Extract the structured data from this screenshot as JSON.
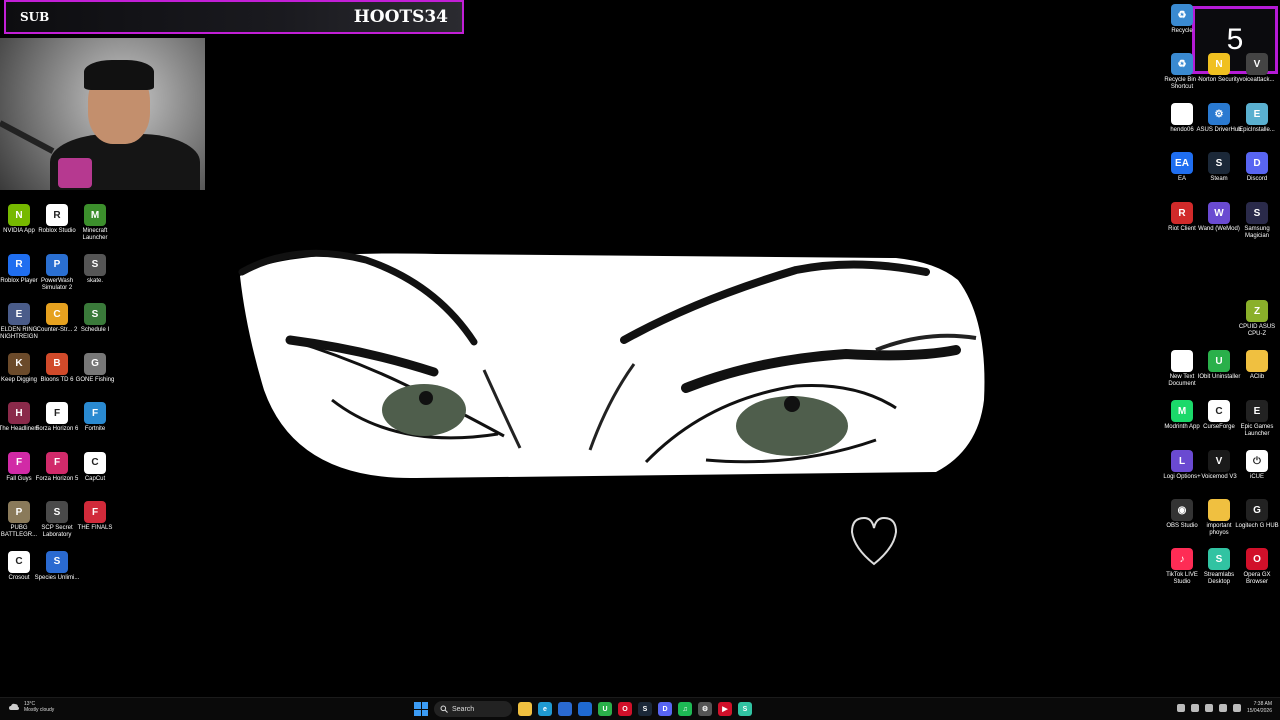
{
  "overlay": {
    "sub_label": "SUB",
    "sub_name": "HOOTS34",
    "countdown": "5"
  },
  "left_icons": [
    {
      "label": "NVIDIA App",
      "icon": "nvidia-icon",
      "color": "#76b900",
      "glyph": "N"
    },
    {
      "label": "Roblox Studio",
      "icon": "roblox-studio-icon",
      "color": "#ffffff",
      "glyph": "R"
    },
    {
      "label": "Minecraft Launcher",
      "icon": "minecraft-icon",
      "color": "#3c8f2c",
      "glyph": "M"
    },
    {
      "label": "Roblox Player",
      "icon": "roblox-player-icon",
      "color": "#1f6ef0",
      "glyph": "R"
    },
    {
      "label": "PowerWash Simulator 2",
      "icon": "powerwash-icon",
      "color": "#2a6fd1",
      "glyph": "P"
    },
    {
      "label": "skate.",
      "icon": "skate-icon",
      "color": "#555555",
      "glyph": "S"
    },
    {
      "label": "ELDEN RING NIGHTREIGN",
      "icon": "elden-ring-icon",
      "color": "#4a5c8a",
      "glyph": "E"
    },
    {
      "label": "Counter-Str... 2",
      "icon": "counter-strike-icon",
      "color": "#e6a11f",
      "glyph": "C"
    },
    {
      "label": "Schedule I",
      "icon": "schedule-icon",
      "color": "#3a7a3a",
      "glyph": "S"
    },
    {
      "label": "Keep Digging",
      "icon": "keep-digging-icon",
      "color": "#6b4a2a",
      "glyph": "K"
    },
    {
      "label": "Bloons TD 6",
      "icon": "bloons-icon",
      "color": "#d14a2a",
      "glyph": "B"
    },
    {
      "label": "GONE Fishing",
      "icon": "gone-fishing-icon",
      "color": "#777777",
      "glyph": "G"
    },
    {
      "label": "The Headliners",
      "icon": "headliners-icon",
      "color": "#8a2a4a",
      "glyph": "H"
    },
    {
      "label": "Forza Horizon 6",
      "icon": "forza6-icon",
      "color": "#ffffff",
      "glyph": "F"
    },
    {
      "label": "Fortnite",
      "icon": "fortnite-icon",
      "color": "#2a8ad1",
      "glyph": "F"
    },
    {
      "label": "Fall Guys",
      "icon": "fall-guys-icon",
      "color": "#d12aa6",
      "glyph": "F"
    },
    {
      "label": "Forza Horizon 5",
      "icon": "forza5-icon",
      "color": "#d12a6a",
      "glyph": "F"
    },
    {
      "label": "CapCut",
      "icon": "capcut-icon",
      "color": "#ffffff",
      "glyph": "C"
    },
    {
      "label": "PUBG BATTLEGR...",
      "icon": "pubg-icon",
      "color": "#8a7a5a",
      "glyph": "P"
    },
    {
      "label": "SCP Secret Laboratory",
      "icon": "scp-icon",
      "color": "#4a4a4a",
      "glyph": "S"
    },
    {
      "label": "THE FINALS",
      "icon": "the-finals-icon",
      "color": "#d12a3a",
      "glyph": "F"
    },
    {
      "label": "Crosout",
      "icon": "crosout-icon",
      "color": "#ffffff",
      "glyph": "C"
    },
    {
      "label": "Species Unlimi...",
      "icon": "species-icon",
      "color": "#2a6ad1",
      "glyph": "S"
    }
  ],
  "right_icons": [
    {
      "label": "Recycle",
      "icon": "recycle-bin-icon",
      "color": "#3a8ad1",
      "glyph": "♻"
    },
    {
      "label": "Recycle Bin - Shortcut",
      "icon": "recycle-bin-shortcut-icon",
      "color": "#3a8ad1",
      "glyph": "♻"
    },
    {
      "label": "Norton Security",
      "icon": "norton-icon",
      "color": "#f0c020",
      "glyph": "N"
    },
    {
      "label": "voiceattack...",
      "icon": "voiceattack-icon",
      "color": "#444444",
      "glyph": "V"
    },
    {
      "label": "hendo06",
      "icon": "file-icon",
      "color": "#ffffff",
      "glyph": ""
    },
    {
      "label": "ASUS DriverHub",
      "icon": "asus-driverhub-icon",
      "color": "#2a7ad1",
      "glyph": "⚙"
    },
    {
      "label": "EpicInstalle...",
      "icon": "epic-installer-icon",
      "color": "#5ab0d0",
      "glyph": "E"
    },
    {
      "label": "EA",
      "icon": "ea-icon",
      "color": "#1f6ef0",
      "glyph": "EA"
    },
    {
      "label": "Steam",
      "icon": "steam-icon",
      "color": "#1b2838",
      "glyph": "S"
    },
    {
      "label": "Discord",
      "icon": "discord-icon",
      "color": "#5865f2",
      "glyph": "D"
    },
    {
      "label": "Riot Client",
      "icon": "riot-client-icon",
      "color": "#d12a2a",
      "glyph": "R"
    },
    {
      "label": "Wand (WeMod)",
      "icon": "wand-icon",
      "color": "#6a4ad1",
      "glyph": "W"
    },
    {
      "label": "Samsung Magician",
      "icon": "samsung-magician-icon",
      "color": "#2a2a4a",
      "glyph": "S"
    },
    {
      "label": "CPUID ASUS CPU-Z",
      "icon": "cpuz-icon",
      "color": "#8ab02a",
      "glyph": "Z"
    },
    {
      "label": "New Text Document",
      "icon": "text-document-icon",
      "color": "#ffffff",
      "glyph": ""
    },
    {
      "label": "IObit Uninstaller",
      "icon": "iobit-icon",
      "color": "#2ab04a",
      "glyph": "U"
    },
    {
      "label": "AClib",
      "icon": "folder-icon",
      "color": "#f0c040",
      "glyph": ""
    },
    {
      "label": "Modrinth App",
      "icon": "modrinth-icon",
      "color": "#1bd96a",
      "glyph": "M"
    },
    {
      "label": "CurseForge",
      "icon": "curseforge-icon",
      "color": "#ffffff",
      "glyph": "C"
    },
    {
      "label": "Epic Games Launcher",
      "icon": "epic-games-icon",
      "color": "#222222",
      "glyph": "E"
    },
    {
      "label": "Logi Options+",
      "icon": "logi-options-icon",
      "color": "#6a4ad1",
      "glyph": "L"
    },
    {
      "label": "Voicemod V3",
      "icon": "voicemod-icon",
      "color": "#1a1a1a",
      "glyph": "V"
    },
    {
      "label": "iCUE",
      "icon": "icue-icon",
      "color": "#ffffff",
      "glyph": "⏻"
    },
    {
      "label": "OBS Studio",
      "icon": "obs-icon",
      "color": "#333333",
      "glyph": "◉"
    },
    {
      "label": "important phoyos",
      "icon": "folder-important-icon",
      "color": "#f0c040",
      "glyph": ""
    },
    {
      "label": "Logitech G HUB",
      "icon": "logitech-ghub-icon",
      "color": "#222222",
      "glyph": "G"
    },
    {
      "label": "TikTok LIVE Studio",
      "icon": "tiktok-live-icon",
      "color": "#fe2c55",
      "glyph": "♪"
    },
    {
      "label": "Streamlabs Desktop",
      "icon": "streamlabs-icon",
      "color": "#31c3a2",
      "glyph": "S"
    },
    {
      "label": "Opera GX Browser",
      "icon": "opera-gx-icon",
      "color": "#d1102a",
      "glyph": "O"
    }
  ],
  "taskbar": {
    "weather_temp": "13°C",
    "weather_desc": "Mostly cloudy",
    "search_placeholder": "Search",
    "time": "7:38 AM",
    "date": "15/04/2026",
    "apps": [
      {
        "icon": "file-explorer-icon",
        "color": "#f0c040",
        "glyph": ""
      },
      {
        "icon": "edge-icon",
        "color": "#1f9ad1",
        "glyph": "e"
      },
      {
        "icon": "store-icon",
        "color": "#2a6ad1",
        "glyph": ""
      },
      {
        "icon": "mail-icon",
        "color": "#1f6ad1",
        "glyph": ""
      },
      {
        "icon": "iobit-taskbar-icon",
        "color": "#2ab04a",
        "glyph": "U"
      },
      {
        "icon": "opera-taskbar-icon",
        "color": "#d1102a",
        "glyph": "O"
      },
      {
        "icon": "steam-taskbar-icon",
        "color": "#1b2838",
        "glyph": "S"
      },
      {
        "icon": "discord-taskbar-icon",
        "color": "#5865f2",
        "glyph": "D"
      },
      {
        "icon": "spotify-icon",
        "color": "#1db954",
        "glyph": "♫"
      },
      {
        "icon": "settings-icon",
        "color": "#555555",
        "glyph": "⚙"
      },
      {
        "icon": "youtube-icon",
        "color": "#d1102a",
        "glyph": "▶"
      },
      {
        "icon": "streamlabs-taskbar-icon",
        "color": "#31c3a2",
        "glyph": "S"
      }
    ]
  }
}
